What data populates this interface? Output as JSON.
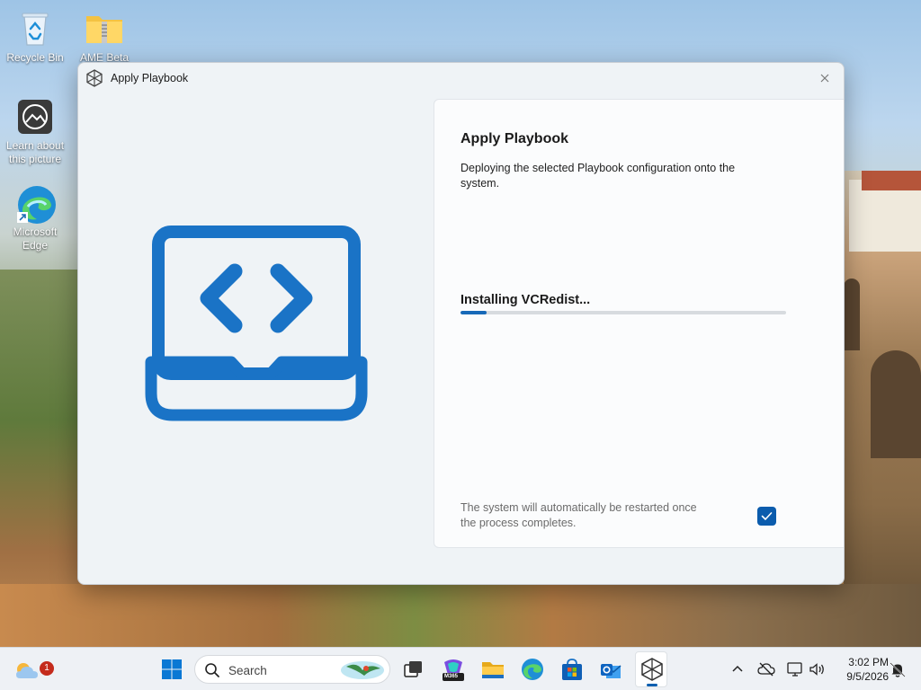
{
  "desktop": {
    "icons": [
      {
        "label": "Recycle Bin"
      },
      {
        "label": "AME Beta"
      },
      {
        "label": "Learn about this picture"
      },
      {
        "label": "Microsoft Edge"
      }
    ]
  },
  "window": {
    "title": "Apply Playbook",
    "panel": {
      "heading": "Apply Playbook",
      "description": "Deploying the selected Playbook configuration onto the system.",
      "status": "Installing VCRedist...",
      "progress_percent": 8,
      "restart_note": "The system will automatically be restarted once the process completes.",
      "restart_checked": true
    }
  },
  "taskbar": {
    "search_label": "Search",
    "weather_badge": "1",
    "time": "3:02 PM",
    "date": "9/5/2026",
    "m365_label": "M365"
  },
  "colors": {
    "accent": "#1769b8",
    "hero_blue": "#1a73c6",
    "checkbox": "#0b5cad"
  }
}
